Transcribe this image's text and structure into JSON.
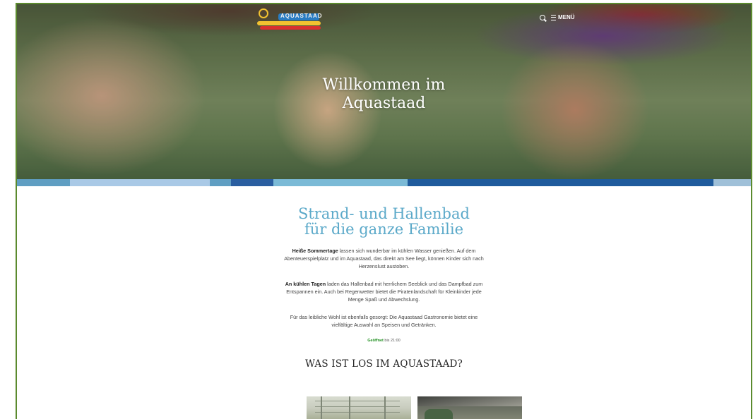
{
  "header": {
    "logo_text": "AQUASTAAD",
    "menu_label": "MENÜ",
    "search_icon": "search-icon",
    "menu_icon": "hamburger-icon"
  },
  "hero": {
    "title_line1": "Willkommen im",
    "title_line2": "Aquastaad"
  },
  "strip_colors": [
    "#5f9ec2",
    "#a9c9e6",
    "#5f9ec2",
    "#2a5ea0",
    "#7bbad6",
    "#1f5b9c",
    "#9fc0d8"
  ],
  "main": {
    "heading_line1": "Strand- und Hallenbad",
    "heading_line2": "für die ganze Familie",
    "p1_bold": "Heiße Sommertage",
    "p1_text": " lassen sich wunderbar im kühlen Wasser genießen. Auf dem Abenteuerspielplatz und im Aquastaad, das direkt am See liegt, können Kinder sich nach Herzenslust austoben.",
    "p2_bold": "An kühlen Tagen",
    "p2_text": " laden das Hallenbad mit herrlichem Seeblick und das Dampfbad zum Entspannen ein. Auch bei Regenwetter bietet die Piratenlandschaft für Kleinkinder jede Menge Spaß und Abwechslung.",
    "p3_text": "Für das leibliche Wohl ist ebenfalls gesorgt: Die Aquastaad Gastronomie bietet eine vielfältige Auswahl an Speisen und Getränken.",
    "open_status": "Geöffnet",
    "open_until": " bis 21:00",
    "subheading": "WAS IST LOS IM AQUASTAAD?"
  }
}
